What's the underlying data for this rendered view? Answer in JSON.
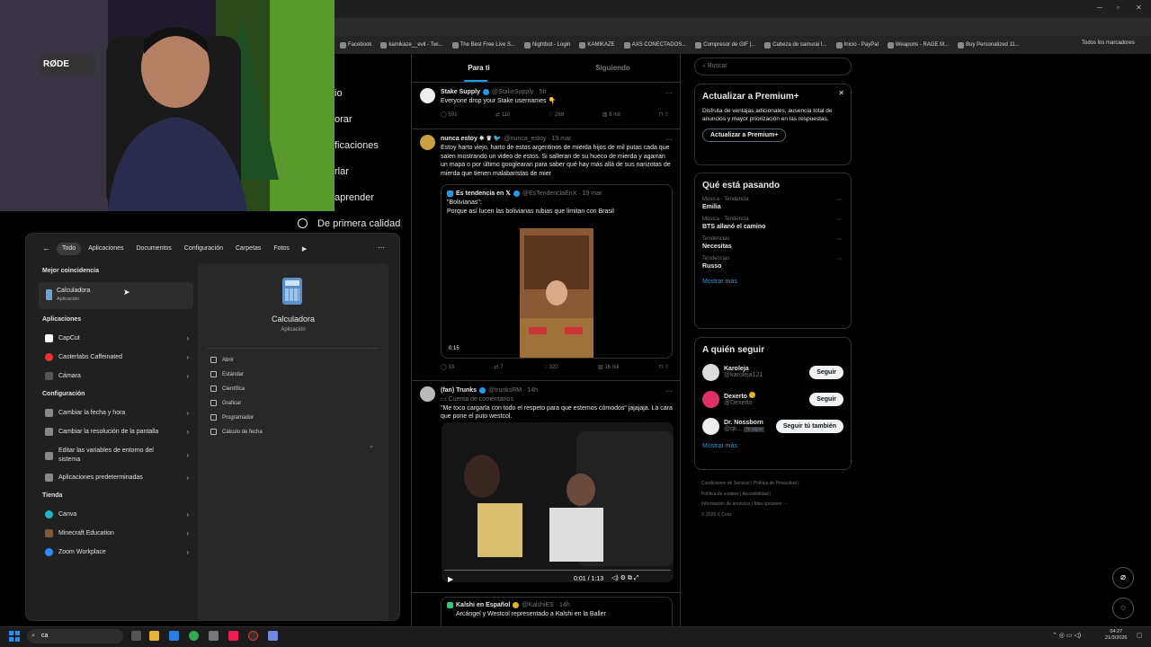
{
  "browser": {
    "bookmarks": [
      "Facebook",
      "kamikaze__evil - Twi...",
      "The Best Free Live S...",
      "Nightbot - Login",
      "KAMIKAZE",
      "AXS CONECTADOS...",
      "Compresor de GIF |...",
      "Cabeza de samurai I...",
      "Inicio - PayPal",
      "Weapons - RAGE M...",
      "Buy Personalized 11..."
    ],
    "all_bookmarks": "Todos los marcadores"
  },
  "overlay_menu": {
    "items": [
      "io",
      "orar",
      "ficaciones",
      "rlar",
      "aprender"
    ],
    "premium_label": "De primera calidad"
  },
  "feed": {
    "tabs": [
      "Para ti",
      "Siguiendo"
    ],
    "tweets": [
      {
        "name": "Stake Supply",
        "handle": "@StakeSupply · 5h",
        "text": "Everyone drop your Stake usernames 👇",
        "replies": "591",
        "retweets": "110",
        "likes": "268",
        "views": "8 mil"
      },
      {
        "name": "nunca estoy ✵ ♛ 🐦",
        "handle": "@nunca_estoy · 19 mar.",
        "text": "Estoy harto viejo, harto de estos argentinos de mierda hijos de mil putas cada que salen mostrando un video de estos. Si salleran de su hueco de mierda y agarran un mapa o por último googlearan para saber qué hay más allá de sus narizotas de mierda que tienen malabaristas de mier",
        "quote": {
          "name": "Es tendencia en 𝕏",
          "handle": "@EsTendenciaEnX · 19 mar.",
          "text1": "\"Bolivianas\":",
          "text2": "Porque así lucen las bolivianas rubias que limitan con Brasil",
          "duration": "0:15"
        },
        "replies": "33",
        "retweets": "7",
        "likes": "320",
        "views": "16 mil"
      },
      {
        "name": "(fan) Trunks",
        "handle": "@trunksRM · 14h",
        "sub": "Cuenta de comentarios",
        "text": "\"Me toco cargarla con todo el respeto para que estemos cómodos\" jajajaja. La cara que pone el puto westcol.",
        "video_time": "0:01 / 1:13"
      },
      {
        "name": "Kalshi en Español",
        "handle": "@KalshiES · 14h",
        "text": "Arcángel y Westcol representado a Kalshi en la Baller"
      }
    ]
  },
  "sidebar": {
    "search_placeholder": "Buscar",
    "premium": {
      "title": "Actualizar a Premium+",
      "body": "Disfruta de ventajas adicionales, ausencia total de anuncios y mayor priorización en las respuestas.",
      "button": "Actualizar a Premium+"
    },
    "trends_title": "Qué está pasando",
    "trends": [
      {
        "cat": "Música · Tendencia",
        "name": "Emilia"
      },
      {
        "cat": "Música · Tendencia",
        "name": "BTS allanó el camino"
      },
      {
        "cat": "Tendencias",
        "name": "Necesitas"
      },
      {
        "cat": "Tendencias",
        "name": "Russo"
      }
    ],
    "show_more": "Mostrar más",
    "follow_title": "A quién seguir",
    "follow": [
      {
        "name": "Karoleja",
        "handle": "@karoleja121",
        "button": "Seguir"
      },
      {
        "name": "Dexerto",
        "handle": "@Dexerto",
        "button": "Seguir"
      },
      {
        "name": "Dr. Nossborn",
        "handle": "@qk...",
        "badge": "Te sigue",
        "button": "Seguir tú también"
      }
    ],
    "footer": [
      "Condiciones de Servicio",
      "Política de Privacidad",
      "Política de cookies",
      "Accesibilidad",
      "Información de anuncios",
      "Más opciones ···",
      "© 2026 X Corp."
    ]
  },
  "start_menu": {
    "filters": [
      "Todo",
      "Aplicaciones",
      "Documentos",
      "Configuración",
      "Carpetas",
      "Fotos"
    ],
    "best_match_title": "Mejor coincidencia",
    "best_match": {
      "name": "Calculadora",
      "type": "Aplicación"
    },
    "apps_title": "Aplicaciones",
    "apps": [
      "CapCut",
      "Casterlabs Caffeinated",
      "Cámara"
    ],
    "settings_title": "Configuración",
    "settings": [
      "Cambiar la fecha y hora",
      "Cambiar la resolución de la pantalla",
      "Editar las variables de entorno del sistema",
      "Aplicaciones predeterminadas"
    ],
    "store_title": "Tienda",
    "store": [
      "Canva",
      "Minecraft Education",
      "Zoom Workplace"
    ],
    "detail": {
      "name": "Calculadora",
      "type": "Aplicación",
      "actions": [
        "Abrir",
        "Estándar",
        "Científica",
        "Graficar",
        "Programador",
        "Cálculo de fecha"
      ]
    }
  },
  "taskbar": {
    "search_value": "ca",
    "time": "04:27",
    "date": "21/3/2026"
  }
}
